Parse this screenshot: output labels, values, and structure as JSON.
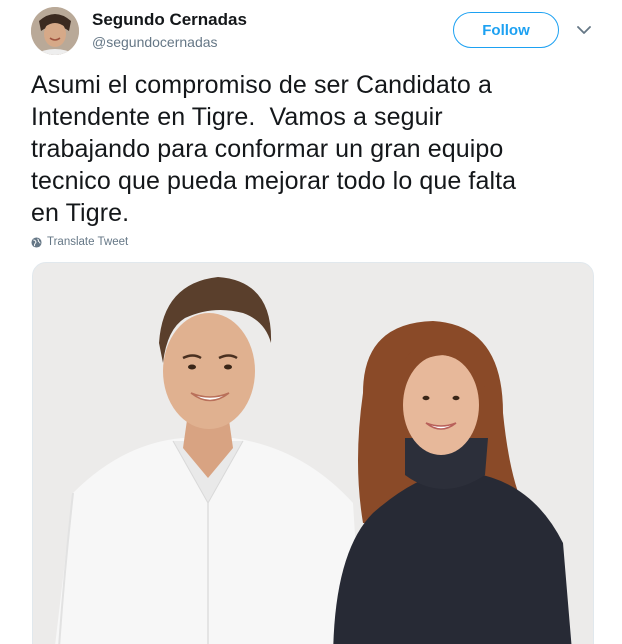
{
  "tweet": {
    "author": {
      "display_name": "Segundo Cernadas",
      "handle": "@segundocernadas",
      "avatar_icon": "profile-photo"
    },
    "follow_label": "Follow",
    "text": "Asumi el compromiso de ser Candidato a\nIntendente en Tigre.  Vamos a seguir\ntrabajando para conformar un gran equipo\ntecnico que pueda mejorar todo lo que falta\nen Tigre.",
    "translate_label": "Translate Tweet",
    "media": {
      "type": "photo",
      "description_icon": "photo-two-people"
    }
  },
  "colors": {
    "accent": "#1da1f2",
    "text": "#14171a",
    "secondary": "#657786",
    "border": "#e1e8ed"
  }
}
